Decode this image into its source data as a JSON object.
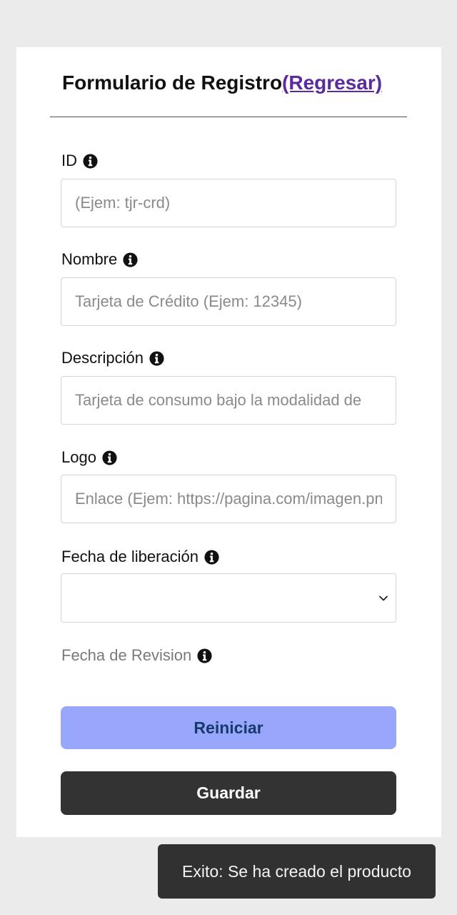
{
  "form": {
    "title": "Formulario de Registro",
    "back_link": "(Regresar)",
    "fields": [
      {
        "label": "ID",
        "placeholder": "(Ejem: tjr-crd)",
        "value": ""
      },
      {
        "label": "Nombre",
        "placeholder": "Tarjeta de Crédito (Ejem: 12345)",
        "value": ""
      },
      {
        "label": "Descripción",
        "placeholder": "Tarjeta de consumo bajo la modalidad de",
        "value": ""
      },
      {
        "label": "Logo",
        "placeholder": "Enlace (Ejem: https://pagina.com/imagen.png)",
        "value": ""
      }
    ],
    "release_date": {
      "label": "Fecha de liberación",
      "selected": ""
    },
    "revision_date": {
      "label": "Fecha de Revision"
    },
    "buttons": {
      "reset": "Reiniciar",
      "save": "Guardar"
    }
  },
  "toast": {
    "message": "Exito: Se ha creado el producto"
  },
  "icons": {
    "info": "info-circle-icon",
    "select": "chevron-down-icon"
  },
  "colors": {
    "page_background": "#ebebeb",
    "card": "#ffffff",
    "link": "#5b2a9e",
    "reset_button": "#98a6fb",
    "reset_text": "#173a6c",
    "save_button": "#333333",
    "toast_background": "#313131"
  }
}
